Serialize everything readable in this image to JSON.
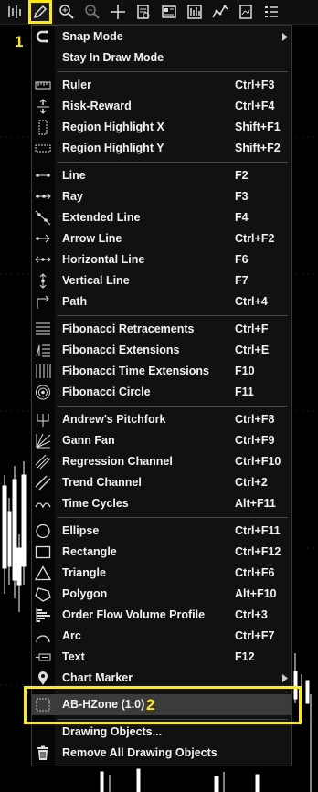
{
  "toolbar": {
    "buttons": [
      {
        "name": "bar-chart-style-icon"
      },
      {
        "name": "pencil-drawing-tools-icon"
      },
      {
        "name": "zoom-in-icon"
      },
      {
        "name": "zoom-out-icon"
      },
      {
        "name": "crosshair-icon"
      },
      {
        "name": "data-box-icon"
      },
      {
        "name": "properties-icon"
      },
      {
        "name": "chart-trader-icon"
      },
      {
        "name": "indicators-icon"
      },
      {
        "name": "strategies-icon"
      },
      {
        "name": "list-icon"
      }
    ]
  },
  "callouts": {
    "one": "1",
    "two": "2"
  },
  "menu": {
    "snap_mode": "Snap Mode",
    "stay_in_draw_mode": "Stay In Draw Mode",
    "ruler": {
      "label": "Ruler",
      "shortcut": "Ctrl+F3"
    },
    "risk_reward": {
      "label": "Risk-Reward",
      "shortcut": "Ctrl+F4"
    },
    "region_x": {
      "label": "Region Highlight X",
      "shortcut": "Shift+F1"
    },
    "region_y": {
      "label": "Region Highlight Y",
      "shortcut": "Shift+F2"
    },
    "line": {
      "label": "Line",
      "shortcut": "F2"
    },
    "ray": {
      "label": "Ray",
      "shortcut": "F3"
    },
    "extended_line": {
      "label": "Extended Line",
      "shortcut": "F4"
    },
    "arrow_line": {
      "label": "Arrow Line",
      "shortcut": "Ctrl+F2"
    },
    "horizontal_line": {
      "label": "Horizontal Line",
      "shortcut": "F6"
    },
    "vertical_line": {
      "label": "Vertical Line",
      "shortcut": "F7"
    },
    "path": {
      "label": "Path",
      "shortcut": "Ctrl+4"
    },
    "fib_retracements": {
      "label": "Fibonacci Retracements",
      "shortcut": "Ctrl+F"
    },
    "fib_extensions": {
      "label": "Fibonacci Extensions",
      "shortcut": "Ctrl+E"
    },
    "fib_time_extensions": {
      "label": "Fibonacci Time Extensions",
      "shortcut": "F10"
    },
    "fib_circle": {
      "label": "Fibonacci Circle",
      "shortcut": "F11"
    },
    "pitchfork": {
      "label": "Andrew's Pitchfork",
      "shortcut": "Ctrl+F8"
    },
    "gann_fan": {
      "label": "Gann Fan",
      "shortcut": "Ctrl+F9"
    },
    "regression_channel": {
      "label": "Regression Channel",
      "shortcut": "Ctrl+F10"
    },
    "trend_channel": {
      "label": "Trend Channel",
      "shortcut": "Ctrl+2"
    },
    "time_cycles": {
      "label": "Time Cycles",
      "shortcut": "Alt+F11"
    },
    "ellipse": {
      "label": "Ellipse",
      "shortcut": "Ctrl+F11"
    },
    "rectangle": {
      "label": "Rectangle",
      "shortcut": "Ctrl+F12"
    },
    "triangle": {
      "label": "Triangle",
      "shortcut": "Ctrl+F6"
    },
    "polygon": {
      "label": "Polygon",
      "shortcut": "Alt+F10"
    },
    "order_flow": {
      "label": "Order Flow Volume Profile",
      "shortcut": "Ctrl+3"
    },
    "arc": {
      "label": "Arc",
      "shortcut": "Ctrl+F7"
    },
    "text": {
      "label": "Text",
      "shortcut": "F12"
    },
    "chart_marker": "Chart Marker",
    "ab_hzone": "AB-HZone (1.0)",
    "drawing_objects": "Drawing Objects...",
    "remove_all": "Remove All Drawing Objects"
  },
  "colors": {
    "highlight": "#ffeb00",
    "menu_bg": "#111111",
    "selected_bg": "#3b3b3b"
  }
}
